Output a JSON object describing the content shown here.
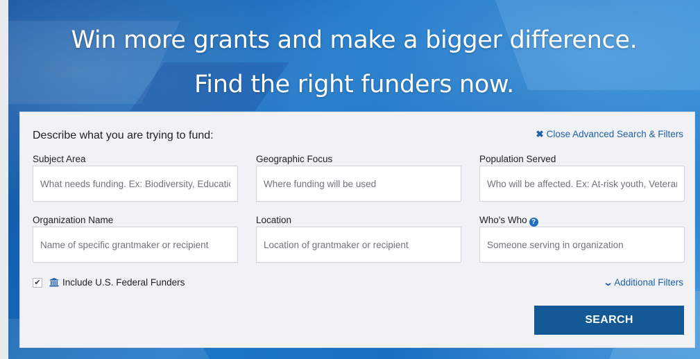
{
  "hero": {
    "headline_line1": "Win more grants and make a bigger difference.",
    "headline_line2": "Find the right funders now."
  },
  "search_panel": {
    "prompt": "Describe what you are trying to fund:",
    "close_advanced_label": "Close Advanced Search & Filters",
    "close_icon": "x-icon",
    "fields": {
      "subject_area": {
        "label": "Subject Area",
        "value": "",
        "placeholder": "What needs funding. Ex: Biodiversity, Education"
      },
      "geographic_focus": {
        "label": "Geographic Focus",
        "value": "",
        "placeholder": "Where funding will be used"
      },
      "population_served": {
        "label": "Population Served",
        "value": "",
        "placeholder": "Who will be affected. Ex: At-risk youth, Veterans"
      },
      "organization_name": {
        "label": "Organization Name",
        "value": "",
        "placeholder": "Name of specific grantmaker or recipient"
      },
      "location": {
        "label": "Location",
        "value": "",
        "placeholder": "Location of grantmaker or recipient"
      },
      "whos_who": {
        "label": "Who's Who",
        "value": "",
        "placeholder": "Someone serving in organization",
        "help_icon": "question-circle-icon"
      }
    },
    "federal_funders": {
      "label": "Include U.S. Federal Funders",
      "checked": true,
      "icon": "government-building-icon"
    },
    "additional_filters_label": "Additional Filters",
    "additional_filters_icon": "chevron-down-icon",
    "search_button_label": "SEARCH",
    "colors": {
      "accent": "#1f5fa8",
      "button": "#145896",
      "panel": "#f1f2f5",
      "hero": "#1a6fc1"
    }
  }
}
